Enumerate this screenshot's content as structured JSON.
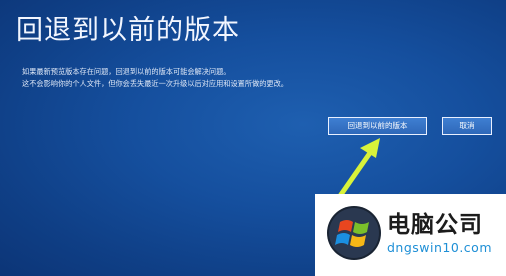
{
  "dialog": {
    "title": "回退到以前的版本",
    "description_line1": "如果最新预览版本存在问题，回退到以前的版本可能会解决问题。",
    "description_line2": "这不会影响你的个人文件，但你会丢失最近一次升级以后对应用和设置所做的更改。",
    "rollback_button_label": "回退到以前的版本",
    "cancel_button_label": "取消"
  },
  "watermark": {
    "name": "电脑公司",
    "url": "dngswin10.com",
    "flag_icon": "windows-flag-icon"
  },
  "colors": {
    "background": "#154f9e",
    "arrow": "#d8f23a",
    "watermark_url": "#1e8fd6"
  }
}
